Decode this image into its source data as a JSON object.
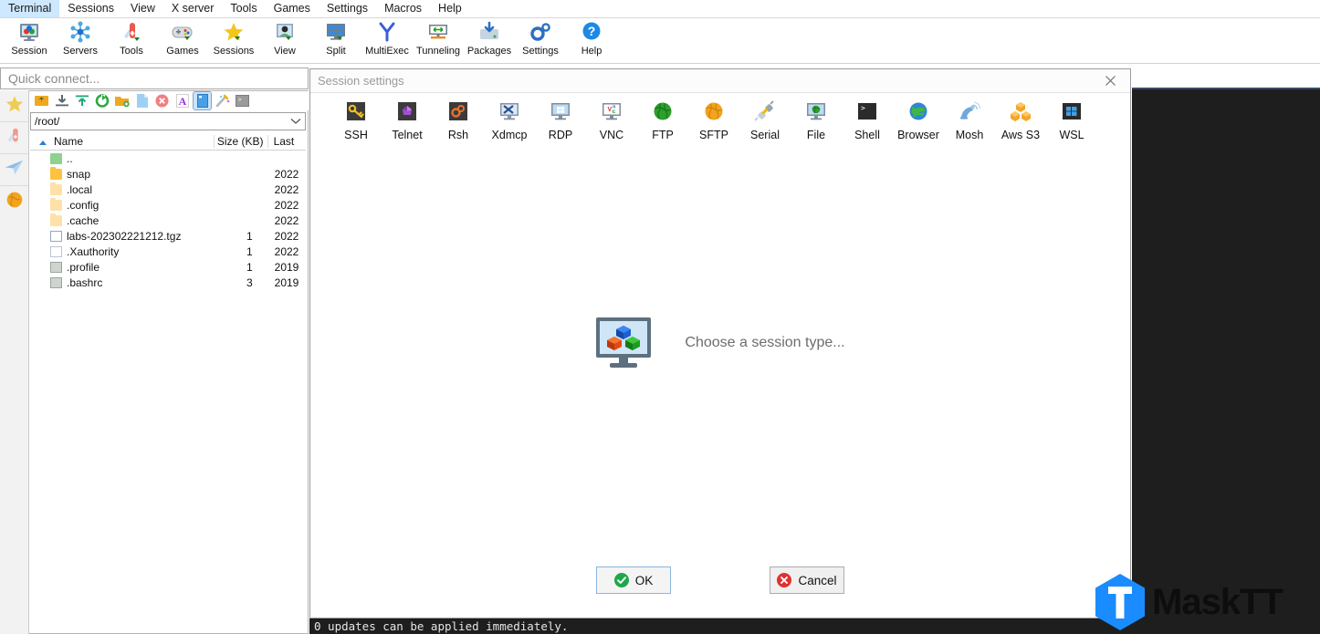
{
  "app": {
    "statusbar_text": "0 updates can be applied immediately."
  },
  "menubar": {
    "items": [
      {
        "label": "Terminal",
        "name": "menu-terminal"
      },
      {
        "label": "Sessions",
        "name": "menu-sessions"
      },
      {
        "label": "View",
        "name": "menu-view"
      },
      {
        "label": "X server",
        "name": "menu-x-server"
      },
      {
        "label": "Tools",
        "name": "menu-tools"
      },
      {
        "label": "Games",
        "name": "menu-games"
      },
      {
        "label": "Settings",
        "name": "menu-settings"
      },
      {
        "label": "Macros",
        "name": "menu-macros"
      },
      {
        "label": "Help",
        "name": "menu-help"
      }
    ]
  },
  "toolbar": {
    "items": [
      {
        "label": "Session",
        "icon": "session-icon"
      },
      {
        "label": "Servers",
        "icon": "servers-icon"
      },
      {
        "label": "Tools",
        "icon": "tools-icon"
      },
      {
        "label": "Games",
        "icon": "games-icon"
      },
      {
        "label": "Sessions",
        "icon": "sessions-star-icon"
      },
      {
        "label": "View",
        "icon": "view-icon"
      },
      {
        "label": "Split",
        "icon": "split-icon"
      },
      {
        "label": "MultiExec",
        "icon": "multiexec-icon"
      },
      {
        "label": "Tunneling",
        "icon": "tunneling-icon"
      },
      {
        "label": "Packages",
        "icon": "packages-icon"
      },
      {
        "label": "Settings",
        "icon": "settings-gear-icon"
      },
      {
        "label": "Help",
        "icon": "help-question-icon"
      }
    ]
  },
  "quick_connect": {
    "placeholder": "Quick connect...",
    "value": ""
  },
  "left_strip": {
    "items": [
      {
        "name": "sidebar-favorites",
        "icon": "star-icon"
      },
      {
        "name": "sidebar-tools",
        "icon": "swiss-knife-icon"
      },
      {
        "name": "sidebar-sftp",
        "icon": "paper-plane-icon"
      },
      {
        "name": "sidebar-globe",
        "icon": "globe-icon"
      }
    ]
  },
  "file_browser": {
    "toolbar_icons": [
      {
        "name": "parent-folder-icon",
        "active": false
      },
      {
        "name": "download-icon",
        "active": false
      },
      {
        "name": "upload-icon",
        "active": false
      },
      {
        "name": "refresh-icon",
        "active": false
      },
      {
        "name": "new-folder-icon",
        "active": false
      },
      {
        "name": "new-file-icon",
        "active": false
      },
      {
        "name": "delete-icon",
        "active": false
      },
      {
        "name": "text-mode-icon",
        "active": false
      },
      {
        "name": "binary-mode-icon",
        "active": true
      },
      {
        "name": "magic-wand-icon",
        "active": false
      },
      {
        "name": "terminal-icon",
        "active": false
      }
    ],
    "path": "/root/",
    "columns": {
      "name": "Name",
      "size": "Size (KB)",
      "last": "Last"
    },
    "rows": [
      {
        "name": "..",
        "size": "",
        "last": "",
        "icon": "up-folder-icon"
      },
      {
        "name": "snap",
        "size": "",
        "last": "2022",
        "icon": "folder-icon"
      },
      {
        "name": ".local",
        "size": "",
        "last": "2022",
        "icon": "folder-pale-icon"
      },
      {
        "name": ".config",
        "size": "",
        "last": "2022",
        "icon": "folder-pale-icon"
      },
      {
        "name": ".cache",
        "size": "",
        "last": "2022",
        "icon": "folder-pale-icon"
      },
      {
        "name": "labs-202302221212.tgz",
        "size": "1",
        "last": "2022",
        "icon": "archive-icon"
      },
      {
        "name": ".Xauthority",
        "size": "1",
        "last": "2022",
        "icon": "document-icon"
      },
      {
        "name": ".profile",
        "size": "1",
        "last": "2019",
        "icon": "script-icon"
      },
      {
        "name": ".bashrc",
        "size": "3",
        "last": "2019",
        "icon": "script-icon"
      }
    ]
  },
  "dialog": {
    "title": "Session settings",
    "close_icon": "close-icon",
    "session_types": [
      {
        "label": "SSH",
        "icon": "ssh-key-icon"
      },
      {
        "label": "Telnet",
        "icon": "telnet-icon"
      },
      {
        "label": "Rsh",
        "icon": "rsh-gears-icon"
      },
      {
        "label": "Xdmcp",
        "icon": "xdmcp-icon"
      },
      {
        "label": "RDP",
        "icon": "rdp-windows-icon"
      },
      {
        "label": "VNC",
        "icon": "vnc-icon"
      },
      {
        "label": "FTP",
        "icon": "ftp-globe-icon"
      },
      {
        "label": "SFTP",
        "icon": "sftp-globe-icon"
      },
      {
        "label": "Serial",
        "icon": "serial-plug-icon"
      },
      {
        "label": "File",
        "icon": "file-monitor-icon"
      },
      {
        "label": "Shell",
        "icon": "shell-prompt-icon"
      },
      {
        "label": "Browser",
        "icon": "browser-globe-icon"
      },
      {
        "label": "Mosh",
        "icon": "mosh-satellite-icon"
      },
      {
        "label": "Aws S3",
        "icon": "aws-s3-icon"
      },
      {
        "label": "WSL",
        "icon": "wsl-windows-icon"
      }
    ],
    "center_text": "Choose a session type...",
    "center_icon": "session-type-monitor-icon",
    "ok_label": "OK",
    "cancel_label": "Cancel"
  },
  "watermark": {
    "text": "MaskTT",
    "logo_letter": "T",
    "accent": "#1a8cff"
  },
  "colors": {
    "accent_blue": "#2a7fd4",
    "folder_orange": "#ffc140",
    "terminal_bg": "#1e1e1e",
    "ok_green": "#22a64a",
    "cancel_red": "#e03131"
  }
}
